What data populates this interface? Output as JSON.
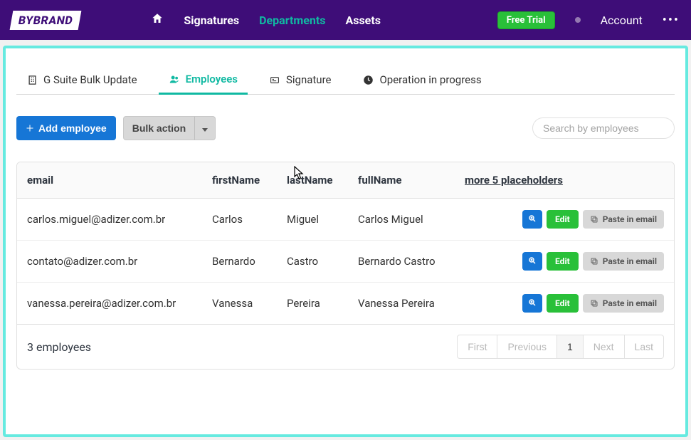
{
  "brand": "BYBRAND",
  "nav": {
    "signatures": "Signatures",
    "departments": "Departments",
    "assets": "Assets",
    "free_trial": "Free Trial",
    "account": "Account"
  },
  "tabs": {
    "bulk": "G Suite Bulk Update",
    "employees": "Employees",
    "signature": "Signature",
    "operation": "Operation in progress"
  },
  "toolbar": {
    "add_employee": "Add employee",
    "bulk_action": "Bulk action",
    "search_placeholder": "Search by employees"
  },
  "table": {
    "headers": {
      "email": "email",
      "firstName": "firstName",
      "lastName": "lastName",
      "fullName": "fullName",
      "more": "more 5 placeholders"
    },
    "actions": {
      "edit": "Edit",
      "paste": "Paste in email"
    },
    "rows": [
      {
        "email": "carlos.miguel@adizer.com.br",
        "firstName": "Carlos",
        "lastName": "Miguel",
        "fullName": "Carlos Miguel"
      },
      {
        "email": "contato@adizer.com.br",
        "firstName": "Bernardo",
        "lastName": "Castro",
        "fullName": "Bernardo Castro"
      },
      {
        "email": "vanessa.pereira@adizer.com.br",
        "firstName": "Vanessa",
        "lastName": "Pereira",
        "fullName": "Vanessa Pereira"
      }
    ]
  },
  "footer": {
    "count": "3 employees"
  },
  "pager": {
    "first": "First",
    "prev": "Previous",
    "page": "1",
    "next": "Next",
    "last": "Last"
  }
}
